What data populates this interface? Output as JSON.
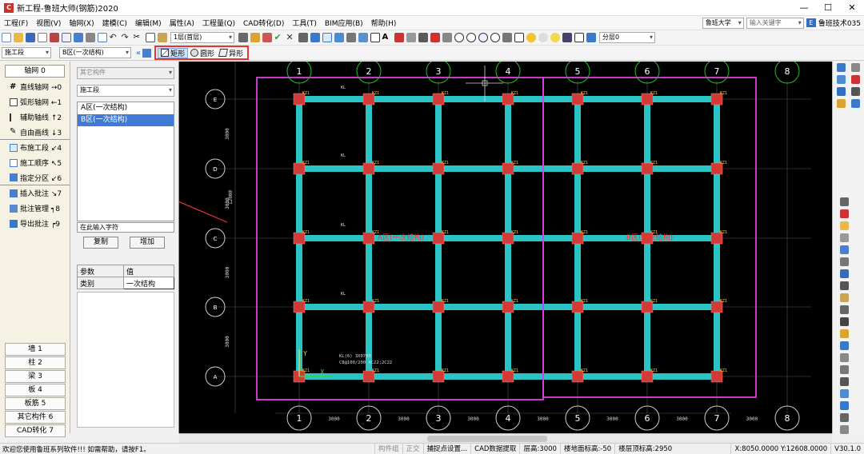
{
  "window": {
    "title": "新工程-鲁班大师(钢筋)2020",
    "logo": "C",
    "minimize": "—",
    "maximize": "☐",
    "close": "✕"
  },
  "menu": {
    "items": [
      "工程(F)",
      "视图(V)",
      "轴网(X)",
      "建模(C)",
      "编辑(M)",
      "属性(A)",
      "工程量(Q)",
      "CAD转化(D)",
      "工具(T)",
      "BIM应用(B)",
      "帮助(H)"
    ],
    "university": "鲁班大学",
    "search_placeholder": "输入关键字",
    "account": "鲁班技术035"
  },
  "toolbar": {
    "floor": "1层(首层)",
    "layer": "分层0"
  },
  "toolbar2": {
    "segment_type": "施工段",
    "zone": "B区(一次结构)",
    "shape_rect": "矩形",
    "shape_circle": "圆形",
    "shape_irregular": "异形"
  },
  "left": {
    "header": "轴网 0",
    "items": [
      {
        "label": "直线轴网 →0",
        "icon": "grid-icon"
      },
      {
        "label": "弧形轴网 ←1",
        "icon": "arc-grid-icon"
      },
      {
        "label": "辅助轴线 ↑2",
        "icon": "aux-axis-icon"
      },
      {
        "label": "自由画线 ↓3",
        "icon": "pencil-icon"
      },
      {
        "label": "布施工段 ↙4",
        "icon": "segment-icon"
      },
      {
        "label": "施工顺序 ↖5",
        "icon": "order-icon"
      },
      {
        "label": "指定分区 ↙6",
        "icon": "zone-icon"
      },
      {
        "label": "插入批注 ↘7",
        "icon": "note-icon"
      },
      {
        "label": "批注管理 ┑8",
        "icon": "note-manage-icon"
      },
      {
        "label": "导出批注 ┍9",
        "icon": "export-icon"
      }
    ],
    "categories": [
      "墙 1",
      "柱 2",
      "梁 3",
      "板 4",
      "板筋 5",
      "其它构件 6",
      "CAD转化 7"
    ]
  },
  "mid": {
    "component_type": "其它构件",
    "segment": "施工段",
    "list": [
      "A区(一次结构)",
      "B区(一次结构)"
    ],
    "input_placeholder": "在此输入字符",
    "copy": "复制",
    "add": "增加",
    "param_header": "参数",
    "value_header": "值",
    "param_name": "类别",
    "param_value": "一次结构"
  },
  "drawing": {
    "axis_top": [
      "1",
      "2",
      "3",
      "4",
      "5",
      "6",
      "7",
      "8"
    ],
    "axis_bottom": [
      "1",
      "2",
      "3",
      "4",
      "5",
      "6",
      "7",
      "8"
    ],
    "axis_left": [
      "E",
      "D",
      "C",
      "B",
      "A"
    ],
    "dims_bottom": [
      "3000",
      "3000",
      "3000",
      "3000",
      "3000",
      "3000",
      "3000"
    ],
    "dims_left": [
      "3000",
      "3000",
      "3000",
      "3000"
    ],
    "dim_total": "12000",
    "zone_a": "A区(一次结构)",
    "zone_b": "B区(一次结构)",
    "col_tag": "KZ1",
    "beam_tag": "KL",
    "note1": "KL(6) 3X0700",
    "note2": "C8@100/200 4C22;2C22",
    "axis_y": "Y",
    "axis_x": "X"
  },
  "status": {
    "help": "欢迎您使用鲁班系列软件!!! 如需帮助，请按F1。",
    "component_group": "构件组",
    "orthogonal": "正交",
    "snap": "捕捉点设置...",
    "cad_extract": "CAD数据提取",
    "floor_height": "层高:3000",
    "floor_base": "楼地面标高:-50",
    "floor_top": "楼层顶标高:2950",
    "coords": "X:8050.0000 Y:12608.0000",
    "version": "V30.1.0"
  },
  "colors": {
    "beam": "#2bc4c4",
    "column": "#d23a36",
    "zone_border": "#e040e0",
    "axis_circle": "#22c322",
    "highlight": "#e33333"
  }
}
